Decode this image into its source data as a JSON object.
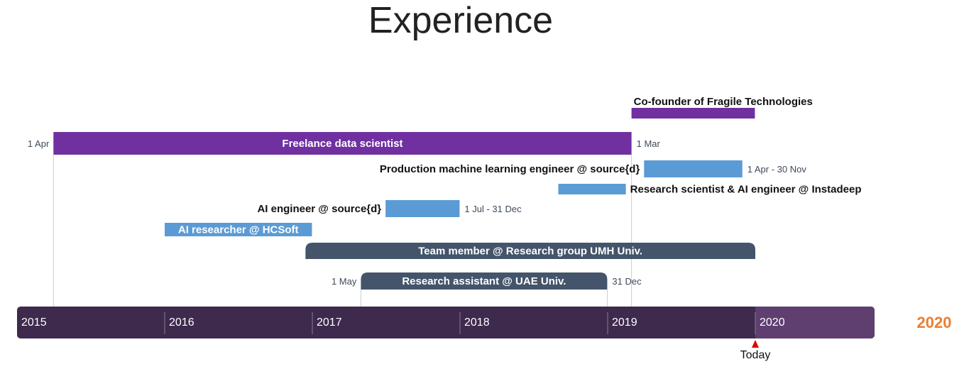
{
  "title": "Experience",
  "chart_data": {
    "type": "timeline",
    "x_axis": {
      "min": "2015-01-01",
      "max": "2021-01-01",
      "tick_labels": [
        "2015",
        "2016",
        "2017",
        "2018",
        "2019",
        "2020"
      ],
      "current_year_label": "2020"
    },
    "today": {
      "label": "Today",
      "date": "2020-01-01"
    },
    "colors": {
      "purple": "#7030a0",
      "blue": "#5b9bd5",
      "slate": "#44546a",
      "axis": "#3d2a4d",
      "axis_future": "#5e3f70",
      "current_year": "#ed7d31",
      "today_marker": "#e00000",
      "leader": "#cccccc"
    },
    "items": [
      {
        "label": "Co-founder of Fragile Technologies",
        "start": "2019-03-01",
        "end": "2019-12-31",
        "color": "purple",
        "start_label": "",
        "end_label": ""
      },
      {
        "label": "Freelance data scientist",
        "start": "2015-04-01",
        "end": "2019-03-01",
        "color": "purple",
        "start_label": "1 Apr",
        "end_label": "1 Mar"
      },
      {
        "label": "Production machine learning engineer @ source{d}",
        "start": "2019-04-01",
        "end": "2019-11-30",
        "color": "blue",
        "start_label": "",
        "end_label": "1 Apr - 30 Nov"
      },
      {
        "label": "Research scientist & AI engineer @ Instadeep",
        "start": "2018-09-01",
        "end": "2019-02-15",
        "color": "blue",
        "start_label": "",
        "end_label": ""
      },
      {
        "label": "AI engineer @ source{d}",
        "start": "2017-07-01",
        "end": "2017-12-31",
        "color": "blue",
        "start_label": "",
        "end_label": "1 Jul - 31 Dec"
      },
      {
        "label": "AI researcher @ HCSoft",
        "start": "2016-01-01",
        "end": "2016-12-31",
        "color": "blue",
        "start_label": "",
        "end_label": ""
      },
      {
        "label": "Team member @ Research group UMH Univ.",
        "start": "2016-12-15",
        "end": "2020-01-01",
        "color": "slate",
        "start_label": "",
        "end_label": ""
      },
      {
        "label": "Research assistant @ UAE Univ.",
        "start": "2017-05-01",
        "end": "2018-12-31",
        "color": "slate",
        "start_label": "1 May",
        "end_label": "31 Dec"
      }
    ]
  }
}
